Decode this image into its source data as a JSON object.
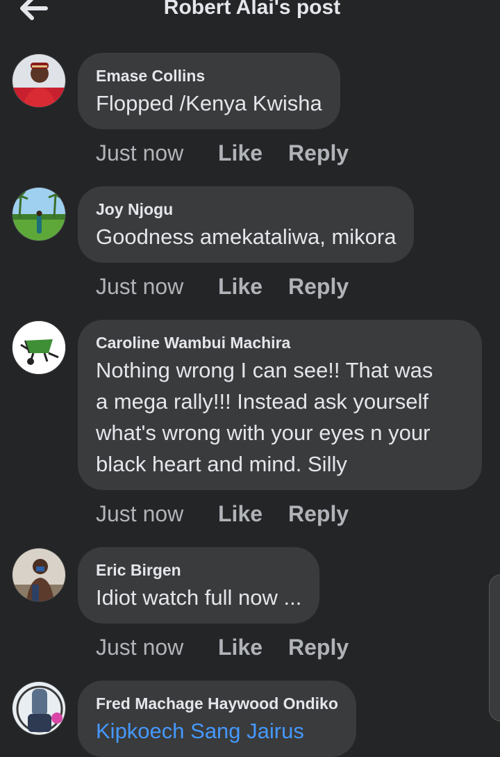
{
  "header": {
    "title": "Robert Alai's post",
    "back_icon": "arrow-left-icon"
  },
  "comments": [
    {
      "author": "Emase Collins",
      "text": "Flopped /Kenya Kwisha",
      "time": "Just now",
      "like_label": "Like",
      "reply_label": "Reply"
    },
    {
      "author": "Joy Njogu",
      "text": "Goodness amekataliwa, mikora",
      "time": "Just now",
      "like_label": "Like",
      "reply_label": "Reply"
    },
    {
      "author": "Caroline Wambui Machira",
      "text_lines": [
        "Nothing wrong I can see!! That was",
        "a mega rally!!! Instead ask yourself",
        "what's wrong with your eyes n your",
        "black heart and mind. Silly"
      ],
      "time": "Just now",
      "like_label": "Like",
      "reply_label": "Reply"
    },
    {
      "author": "Eric Birgen",
      "text": "Idiot watch full now ...",
      "time": "Just now",
      "like_label": "Like",
      "reply_label": "Reply"
    },
    {
      "author": "Fred Machage Haywood Ondiko",
      "mention": "Kipkoech Sang Jairus"
    }
  ],
  "colors": {
    "background": "#242526",
    "bubble": "#3a3b3c",
    "text": "#e4e6eb",
    "secondary_text": "#b0b3b8",
    "link": "#4599ff"
  }
}
